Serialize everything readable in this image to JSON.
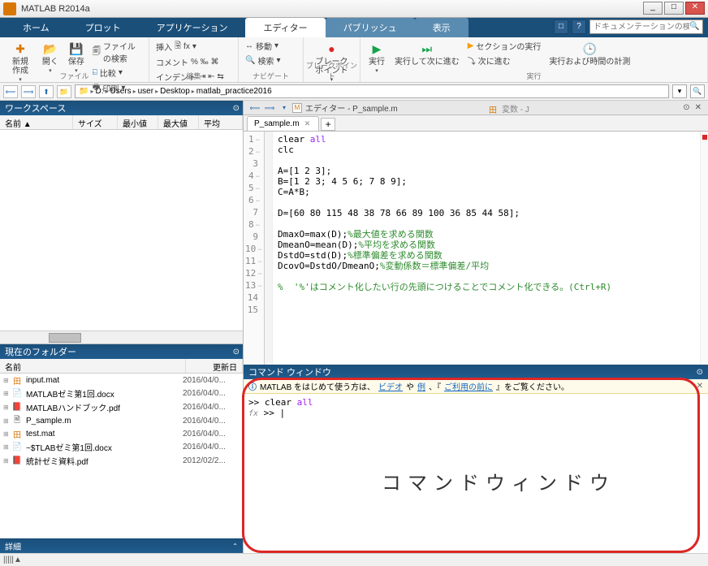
{
  "titlebar": {
    "title": "MATLAB R2014a"
  },
  "ribbon": {
    "tabs": [
      "ホーム",
      "プロット",
      "アプリケーション",
      "エディター",
      "パブリッシュ",
      "表示"
    ],
    "active_index": 3,
    "search_placeholder": "ドキュメンテーションの検索"
  },
  "toolstrip": {
    "groups": {
      "file": {
        "label": "ファイル",
        "new": "新規作成",
        "open": "開く",
        "save": "保存",
        "findfiles": "ファイルの検索",
        "compare": "比較",
        "print": "印刷"
      },
      "edit": {
        "label": "編集",
        "insert": "挿入",
        "comment": "コメント",
        "indent": "インデント",
        "fx": "fx"
      },
      "navigate": {
        "label": "ナビゲート",
        "goto": "移動",
        "find": "検索"
      },
      "breakpoints": {
        "label": "ブレークポイント",
        "btn": "ブレークポイント"
      },
      "run": {
        "label": "実行",
        "run": "実行",
        "advance": "実行して次に進む",
        "section": "セクションの実行",
        "step": "次に進む",
        "time": "実行および時間の計測"
      }
    }
  },
  "path": {
    "segs": [
      "D:",
      "Users",
      "user",
      "Desktop",
      "matlab_practice2016"
    ]
  },
  "workspace": {
    "title": "ワークスペース",
    "cols": [
      "名前 ▲",
      "サイズ",
      "最小値",
      "最大値",
      "平均"
    ]
  },
  "curfolder": {
    "title": "現在のフォルダー",
    "cols": [
      "名前",
      "更新日"
    ],
    "rows": [
      {
        "icon": "mat",
        "name": "input.mat",
        "date": "2016/04/0..."
      },
      {
        "icon": "doc",
        "name": "MATLABゼミ第1回.docx",
        "date": "2016/04/0..."
      },
      {
        "icon": "pdf",
        "name": "MATLABハンドブック.pdf",
        "date": "2016/04/0..."
      },
      {
        "icon": "m",
        "name": "P_sample.m",
        "date": "2016/04/0..."
      },
      {
        "icon": "mat",
        "name": "test.mat",
        "date": "2016/04/0..."
      },
      {
        "icon": "doc",
        "name": "~$TLABゼミ第1回.docx",
        "date": "2016/04/0..."
      },
      {
        "icon": "pdf",
        "name": "統計ゼミ資料.pdf",
        "date": "2012/02/2..."
      }
    ]
  },
  "details": {
    "title": "詳細"
  },
  "editor": {
    "title": "エディター - P_sample.m",
    "vars_title": "変数 - J",
    "filetab": "P_sample.m",
    "lines": [
      {
        "n": 1,
        "dash": "−",
        "html": "clear <span class='st'>all</span>"
      },
      {
        "n": 2,
        "dash": "−",
        "html": "clc"
      },
      {
        "n": 3,
        "dash": "",
        "html": ""
      },
      {
        "n": 4,
        "dash": "−",
        "html": "A=[1 2 3];"
      },
      {
        "n": 5,
        "dash": "−",
        "html": "B=[1 2 3; 4 5 6; 7 8 9];"
      },
      {
        "n": 6,
        "dash": "−",
        "html": "C=A*B;"
      },
      {
        "n": 7,
        "dash": "",
        "html": ""
      },
      {
        "n": 8,
        "dash": "−",
        "html": "D=[60 80 115 48 38 78 66 89 100 36 85 44 58];"
      },
      {
        "n": 9,
        "dash": "",
        "html": ""
      },
      {
        "n": 10,
        "dash": "−",
        "html": "DmaxO=max(D);<span class='cm'>%最大値を求める関数</span>"
      },
      {
        "n": 11,
        "dash": "−",
        "html": "DmeanO=mean(D);<span class='cm'>%平均を求める関数</span>"
      },
      {
        "n": 12,
        "dash": "−",
        "html": "DstdO=std(D);<span class='cm'>%標準偏差を求める関数</span>"
      },
      {
        "n": 13,
        "dash": "−",
        "html": "DcovO=DstdO/DmeanO;<span class='cm'>%変動係数＝標準偏差/平均</span>"
      },
      {
        "n": 14,
        "dash": "",
        "html": ""
      },
      {
        "n": 15,
        "dash": "",
        "html": "<span class='cm'>%  '%'はコメント化したい行の先頭につけることでコメント化できる。(Ctrl+R)</span>"
      }
    ]
  },
  "cmd": {
    "title": "コマンド ウィンドウ",
    "info_pre": "MATLAB をはじめて使う方は、",
    "info_link1": "ビデオ",
    "info_mid": "や",
    "info_link2": "例",
    "info_mid2": "、『",
    "info_link3": "ご利用の前に",
    "info_post": "』をご覧ください。",
    "lines": [
      ">> clear all",
      "fx >> "
    ],
    "big_label": "コマンドウィンドウ"
  },
  "statusbar": {
    "text": "|||||▲"
  }
}
